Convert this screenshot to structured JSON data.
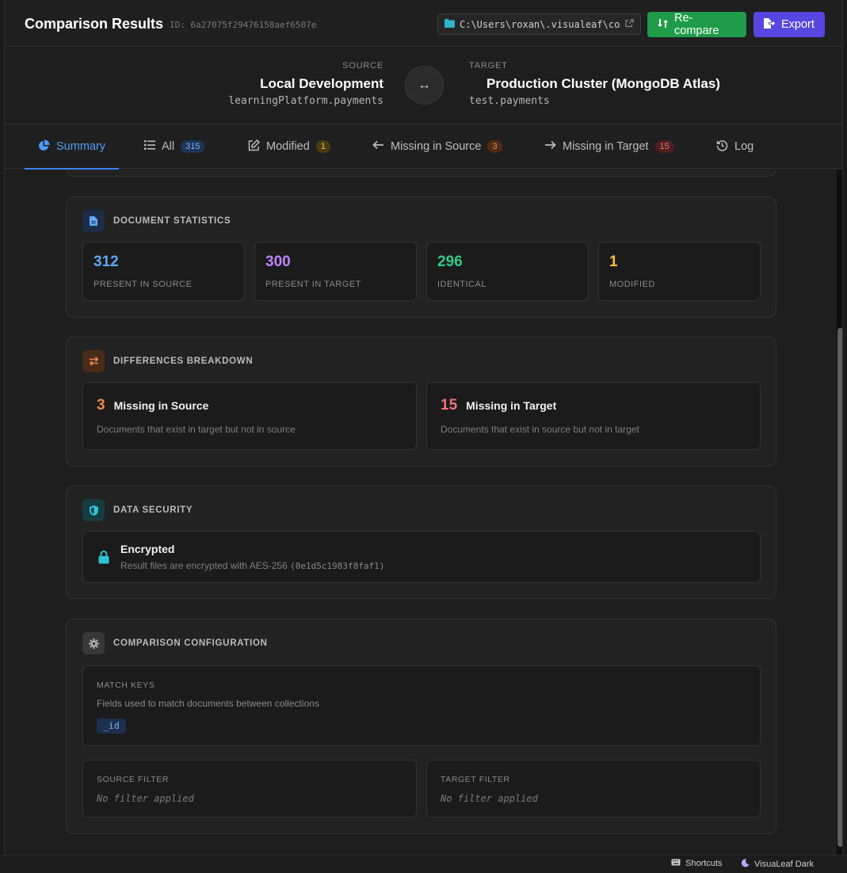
{
  "header": {
    "title": "Comparison Results",
    "comparison_id": "ID: 6a27075f29476158aef6507e",
    "path": "C:\\Users\\roxan\\.visualeaf\\co…",
    "recompare_label": "Re-compare",
    "export_label": "Export"
  },
  "connection": {
    "source_label": "SOURCE",
    "source_name": "Local Development",
    "source_db": "learningPlatform.payments",
    "target_label": "TARGET",
    "target_name": "Production Cluster (MongoDB Atlas)",
    "target_db": "test.payments"
  },
  "tabs": [
    {
      "label": "Summary",
      "badge": null
    },
    {
      "label": "All",
      "badge": "315"
    },
    {
      "label": "Modified",
      "badge": "1"
    },
    {
      "label": "Missing in Source",
      "badge": "3"
    },
    {
      "label": "Missing in Target",
      "badge": "15"
    },
    {
      "label": "Log",
      "badge": null
    }
  ],
  "document_statistics": {
    "title": "DOCUMENT STATISTICS",
    "stats": [
      {
        "value": "312",
        "caption": "PRESENT IN SOURCE",
        "color": "#5fa8f5"
      },
      {
        "value": "300",
        "caption": "PRESENT IN TARGET",
        "color": "#c084fc"
      },
      {
        "value": "296",
        "caption": "IDENTICAL",
        "color": "#34c98a"
      },
      {
        "value": "1",
        "caption": "MODIFIED",
        "color": "#f5c542"
      }
    ]
  },
  "differences": {
    "title": "DIFFERENCES BREAKDOWN",
    "items": [
      {
        "value": "3",
        "title": "Missing in Source",
        "desc": "Documents that exist in target but not in source",
        "color": "#f08a4b"
      },
      {
        "value": "15",
        "title": "Missing in Target",
        "desc": "Documents that exist in source but not in target",
        "color": "#f07178"
      }
    ]
  },
  "security": {
    "title": "DATA SECURITY",
    "status": "Encrypted",
    "desc": "Result files are encrypted with AES-256",
    "key": "(0e1d5c1983f8faf1)"
  },
  "configuration": {
    "title": "COMPARISON CONFIGURATION",
    "match_keys_label": "MATCH KEYS",
    "match_keys_desc": "Fields used to match documents between collections",
    "match_key": "_id",
    "source_filter_label": "SOURCE FILTER",
    "source_filter_value": "No filter applied",
    "target_filter_label": "TARGET FILTER",
    "target_filter_value": "No filter applied"
  },
  "statusbar": {
    "shortcuts": "Shortcuts",
    "theme": "VisuaLeaf Dark"
  }
}
